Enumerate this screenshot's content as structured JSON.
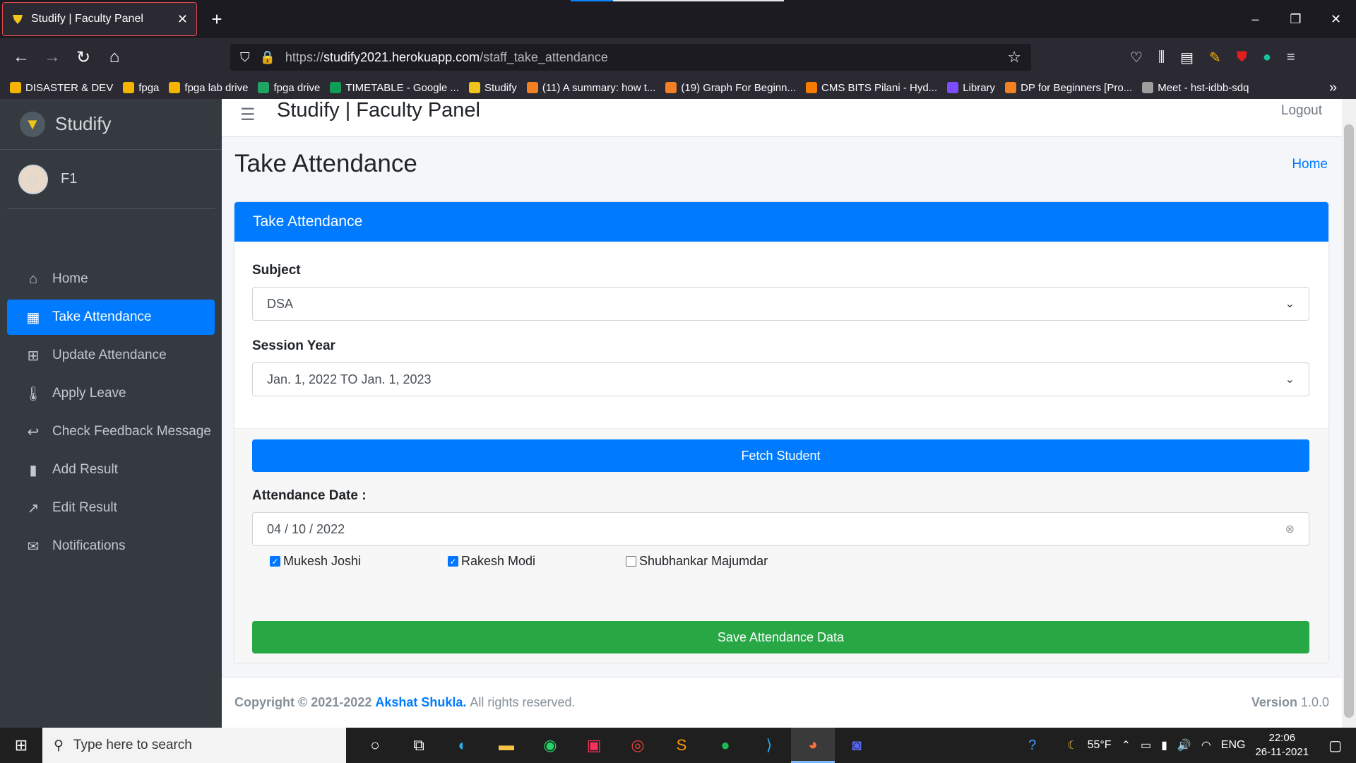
{
  "browser": {
    "tab_title": "Studify | Faculty Panel",
    "tab_close": "✕",
    "new_tab": "+",
    "url_prefix": "https://",
    "url_domain": "studify2021.herokuapp.com",
    "url_path": "/staff_take_attendance",
    "bookmarks": [
      {
        "label": "DISASTER & DEV",
        "color": "#f4b400"
      },
      {
        "label": "fpga",
        "color": "#f4b400"
      },
      {
        "label": "fpga lab drive",
        "color": "#f4b400"
      },
      {
        "label": "fpga drive",
        "color": "#1fa463"
      },
      {
        "label": "TIMETABLE - Google ...",
        "color": "#0f9d58"
      },
      {
        "label": "Studify",
        "color": "#f0c419"
      },
      {
        "label": "(11) A summary: how t...",
        "color": "#f48024"
      },
      {
        "label": "(19) Graph For Beginn...",
        "color": "#f48024"
      },
      {
        "label": "CMS BITS Pilani - Hyd...",
        "color": "#f57c00"
      },
      {
        "label": "Library",
        "color": "#7c4dff"
      },
      {
        "label": "DP for Beginners [Pro...",
        "color": "#f48024"
      },
      {
        "label": "Meet - hst-idbb-sdq",
        "color": "#9e9e9e"
      }
    ]
  },
  "sidebar": {
    "brand": "Studify",
    "user_name": "F1",
    "items": [
      {
        "label": "Home",
        "icon": "home-icon",
        "glyph": "⌂",
        "active": false
      },
      {
        "label": "Take Attendance",
        "icon": "calendar-icon",
        "glyph": "▦",
        "active": true
      },
      {
        "label": "Update Attendance",
        "icon": "calendar-plus-icon",
        "glyph": "⊞",
        "active": false
      },
      {
        "label": "Apply Leave",
        "icon": "thermometer-icon",
        "glyph": "🌡",
        "active": false
      },
      {
        "label": "Check Feedback Message",
        "icon": "reply-icon",
        "glyph": "↩",
        "active": false
      },
      {
        "label": "Add Result",
        "icon": "bar-chart-icon",
        "glyph": "▮",
        "active": false
      },
      {
        "label": "Edit Result",
        "icon": "line-chart-icon",
        "glyph": "↗",
        "active": false
      },
      {
        "label": "Notifications",
        "icon": "inbox-icon",
        "glyph": "✉",
        "active": false
      }
    ]
  },
  "header": {
    "panel_title": "Studify | Faculty Panel",
    "logout": "Logout"
  },
  "page": {
    "title": "Take Attendance",
    "breadcrumb_home": "Home"
  },
  "card": {
    "header": "Take Attendance",
    "subject_label": "Subject",
    "subject_value": "DSA",
    "session_label": "Session Year",
    "session_value": "Jan. 1, 2022 TO Jan. 1, 2023",
    "fetch_button": "Fetch Student",
    "date_label": "Attendance Date :",
    "date_value": "04 / 10 / 2022",
    "students": [
      {
        "name": "Mukesh Joshi",
        "checked": true
      },
      {
        "name": "Rakesh Modi",
        "checked": true
      },
      {
        "name": "Shubhankar Majumdar",
        "checked": false
      }
    ],
    "save_button": "Save Attendance Data"
  },
  "footer": {
    "copyright": "Copyright © 2021-2022",
    "author": "Akshat Shukla.",
    "rights": "All rights reserved.",
    "version_label": "Version",
    "version_value": "1.0.0"
  },
  "taskbar": {
    "search_placeholder": "Type here to search",
    "weather": "55°F",
    "language": "ENG",
    "time": "22:06",
    "date": "26-11-2021"
  },
  "colors": {
    "primary": "#007bff",
    "success": "#28a745",
    "sidebar_bg": "#343a40"
  }
}
